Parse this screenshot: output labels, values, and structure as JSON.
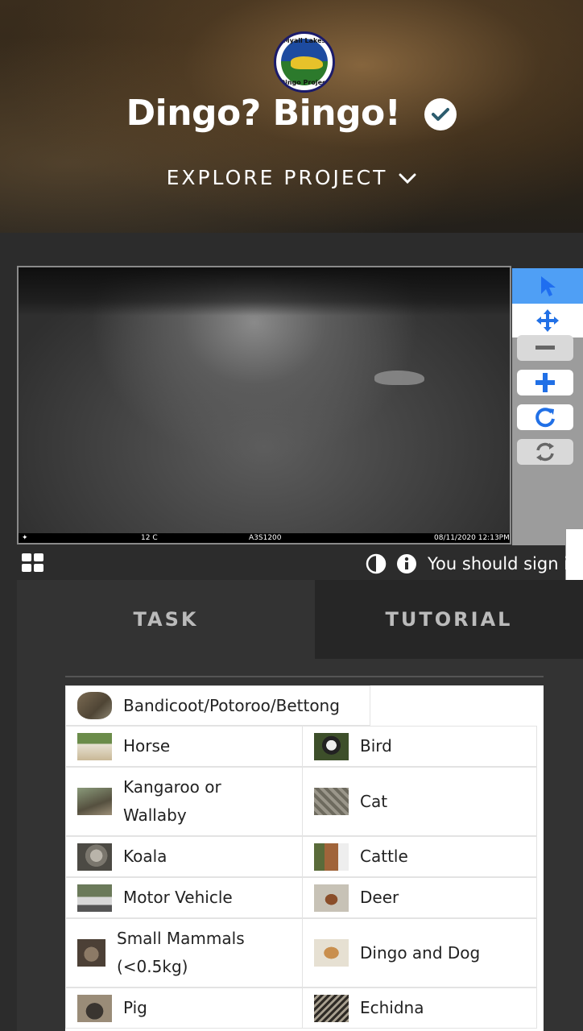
{
  "header": {
    "logo_top": "Myall Lakes",
    "logo_bottom": "Dingo Project",
    "title": "Dingo? Bingo!",
    "explore": "EXPLORE PROJECT"
  },
  "camera": {
    "temperature": "12 C",
    "camera_id": "A3S1200",
    "timestamp": "08/11/2020 12:13PM"
  },
  "meta": {
    "signin_text": "You should sign in"
  },
  "tabs": {
    "task": "TASK",
    "tutorial": "TUTORIAL"
  },
  "choices": [
    "Bandicoot/Potoroo/Bettong",
    "Horse",
    "Bird",
    "Kangaroo or Wallaby",
    "Cat",
    "Koala",
    "Cattle",
    "Motor Vehicle",
    "Deer",
    "Small Mammals (<0.5kg)",
    "Dingo and Dog",
    "Pig",
    "Echidna"
  ],
  "colors": {
    "accent": "#4f9ff5",
    "background": "#2c2c2c"
  }
}
